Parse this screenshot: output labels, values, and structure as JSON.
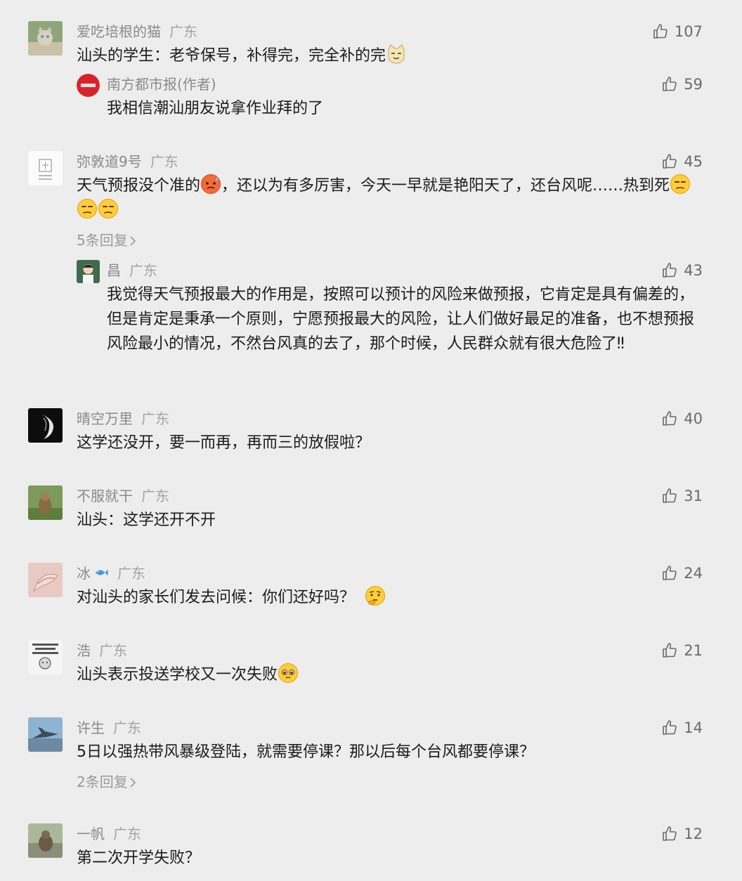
{
  "comments": [
    {
      "user": "爱吃培根的猫",
      "region": "广东",
      "likes": "107",
      "text": "汕头的学生：老爷保号，补得完，完全补的完",
      "reply": {
        "user": "南方都市报(作者)",
        "likes": "59",
        "text": "我相信潮汕朋友说拿作业拜的了"
      }
    },
    {
      "user": "弥敦道9号",
      "region": "广东",
      "likes": "45",
      "text_a": "天气预报没个准的",
      "text_b": "，还以为有多厉害，今天一早就是艳阳天了，还台风呢……热到死",
      "more": "5条回复",
      "reply": {
        "user": "昌",
        "region": "广东",
        "likes": "43",
        "text": "我觉得天气预报最大的作用是，按照可以预计的风险来做预报，它肯定是具有偏差的，但是肯定是秉承一个原则，宁愿预报最大的风险，让人们做好最足的准备，也不想预报风险最小的情况，不然台风真的去了，那个时候，人民群众就有很大危险了‼"
      }
    },
    {
      "user": "晴空万里",
      "region": "广东",
      "likes": "40",
      "text": "这学还没开，要一而再，再而三的放假啦？"
    },
    {
      "user": "不服就干",
      "region": "广东",
      "likes": "31",
      "text": "汕头：这学还开不开"
    },
    {
      "user": "冰",
      "region": "广东",
      "likes": "24",
      "text": "对汕头的家长们发去问候：你们还好吗？"
    },
    {
      "user": "浩",
      "region": "广东",
      "likes": "21",
      "text": "汕头表示投送学校又一次失败"
    },
    {
      "user": "许生",
      "region": "广东",
      "likes": "14",
      "text": "5日以强热带风暴级登陆，就需要停课？那以后每个台风都要停课？",
      "more": "2条回复"
    },
    {
      "user": "一帆",
      "region": "广东",
      "likes": "12",
      "text": "第二次开学失败？"
    }
  ],
  "colors": {
    "background": "#ededed",
    "username": "#8a8a8a",
    "text": "#1b1b1b",
    "like": "#6a6a6a"
  },
  "icons": [
    "thumbs-up-icon",
    "chevron-right-icon",
    "cat-emoji",
    "sweat-emoji",
    "unamused-emoji",
    "thinking-emoji",
    "pleading-emoji",
    "fish-emoji"
  ]
}
